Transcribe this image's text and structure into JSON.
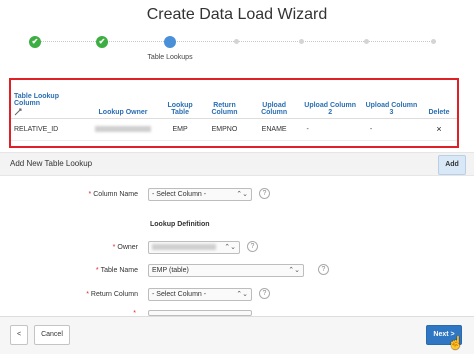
{
  "window": {
    "title": "Create Data Load Wizard"
  },
  "progress": {
    "current_step_label": "Table Lookups"
  },
  "lookup_table": {
    "headers": [
      "Table Lookup Column",
      "Lookup Owner",
      "Lookup Table",
      "Return Column",
      "Upload Column",
      "Upload Column 2",
      "Upload Column 3",
      "Delete"
    ],
    "rows": [
      {
        "lookup_column": "RELATIVE_ID",
        "lookup_table": "EMP",
        "return_column": "EMPNO",
        "upload_column": "ENAME",
        "upload_column_2": "-",
        "upload_column_3": "-",
        "delete": "×"
      }
    ]
  },
  "add_section": {
    "title": "Add New Table Lookup",
    "add_button": "Add",
    "column_name": {
      "label": "Column Name",
      "value": "- Select Column -"
    },
    "lookup_definition": "Lookup Definition",
    "owner": {
      "label": "Owner"
    },
    "table_name": {
      "label": "Table Name",
      "value": "EMP (table)"
    },
    "return_column": {
      "label": "Return Column",
      "value": "- Select Column -"
    }
  },
  "footer": {
    "prev": "<",
    "cancel": "Cancel",
    "next": "Next >"
  },
  "icons": {
    "check": "✔",
    "help": "?",
    "chevron": "⌃⌄"
  }
}
